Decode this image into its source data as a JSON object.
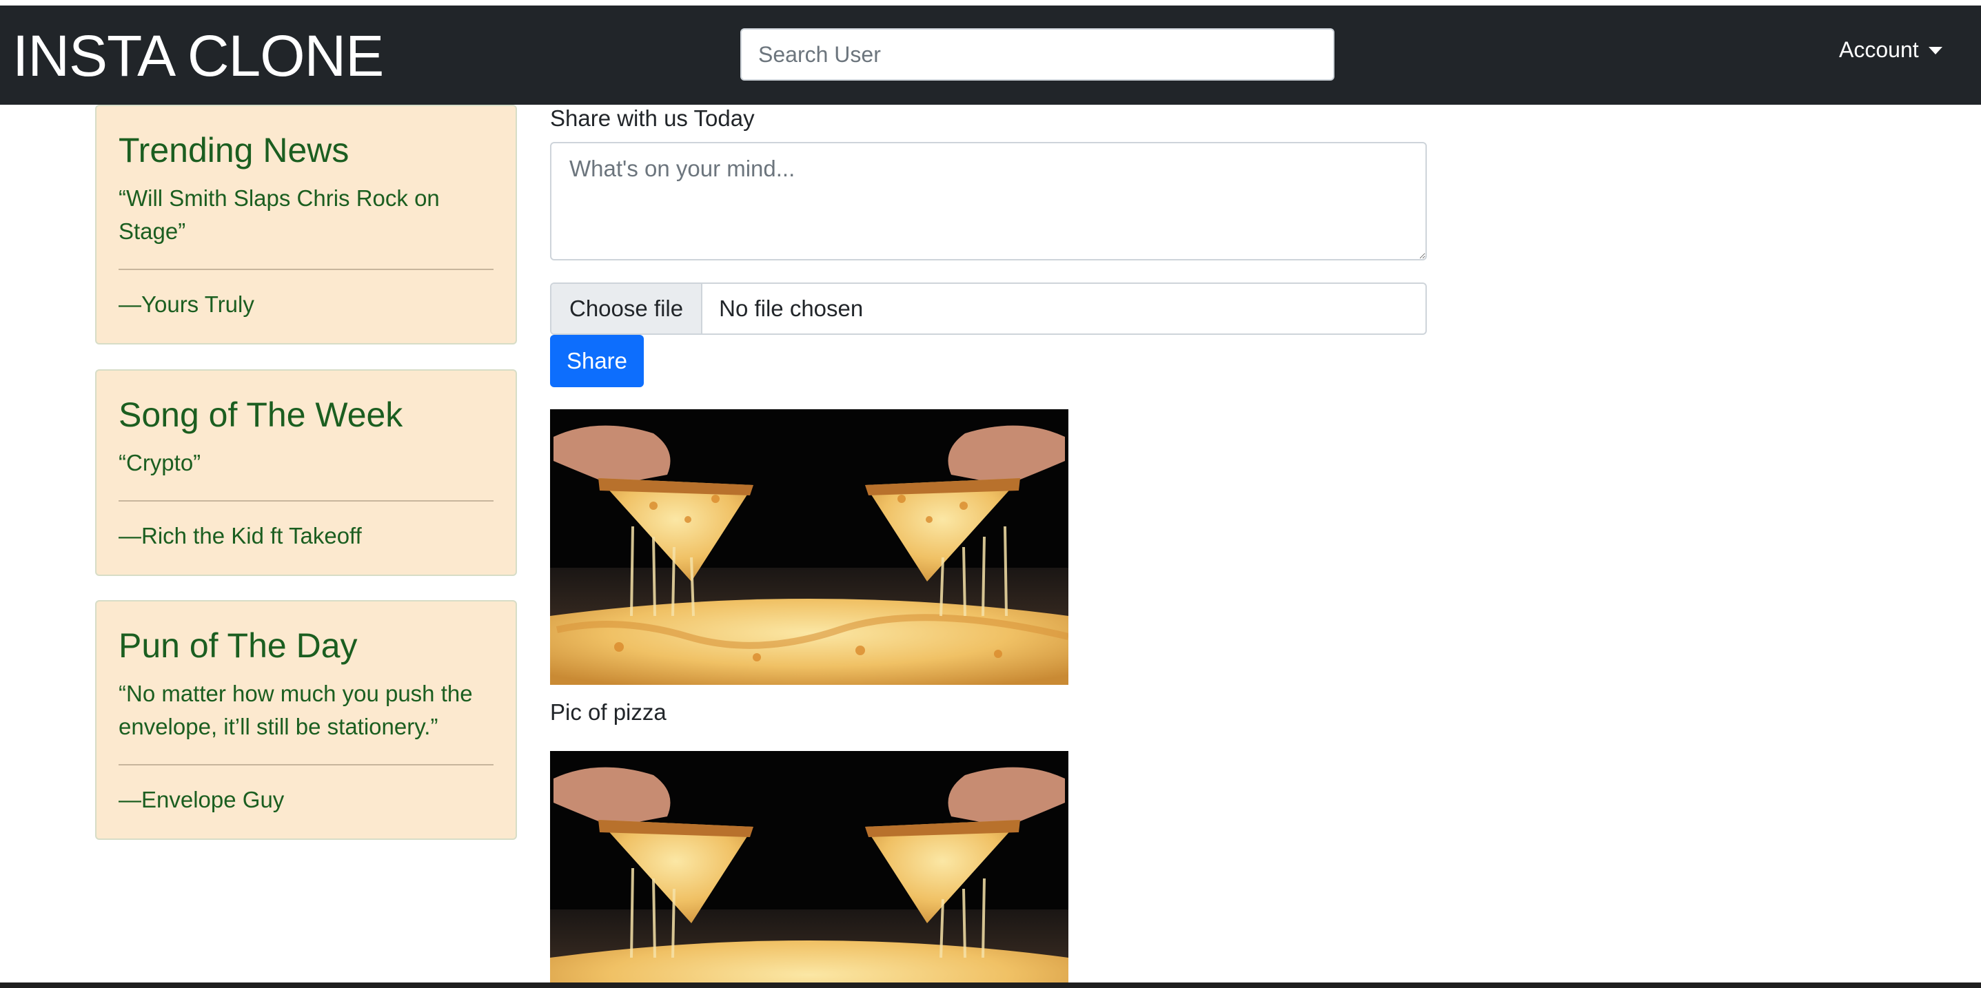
{
  "navbar": {
    "brand": "INSTA CLONE",
    "search_placeholder": "Search User",
    "account_label": "Account"
  },
  "sidebar": {
    "cards": [
      {
        "title": "Trending News",
        "quote": "“Will Smith Slaps Chris Rock on Stage”",
        "author": "—Yours Truly"
      },
      {
        "title": "Song of The Week",
        "quote": "“Crypto”",
        "author": "—Rich the Kid ft Takeoff"
      },
      {
        "title": "Pun of The Day",
        "quote": "“No matter how much you push the envelope, it’ll still be stationery.”",
        "author": "—Envelope Guy"
      }
    ]
  },
  "composer": {
    "label": "Share with us Today",
    "placeholder": "What's on your mind...",
    "file_button": "Choose file",
    "file_status": "No file chosen",
    "share_button": "Share"
  },
  "feed": {
    "posts": [
      {
        "caption": "Pic of pizza"
      },
      {
        "caption": ""
      }
    ]
  },
  "colors": {
    "navbar": "#212529",
    "card_bg": "#fce9cf",
    "card_text": "#1b5e20",
    "primary": "#0d6efd"
  }
}
